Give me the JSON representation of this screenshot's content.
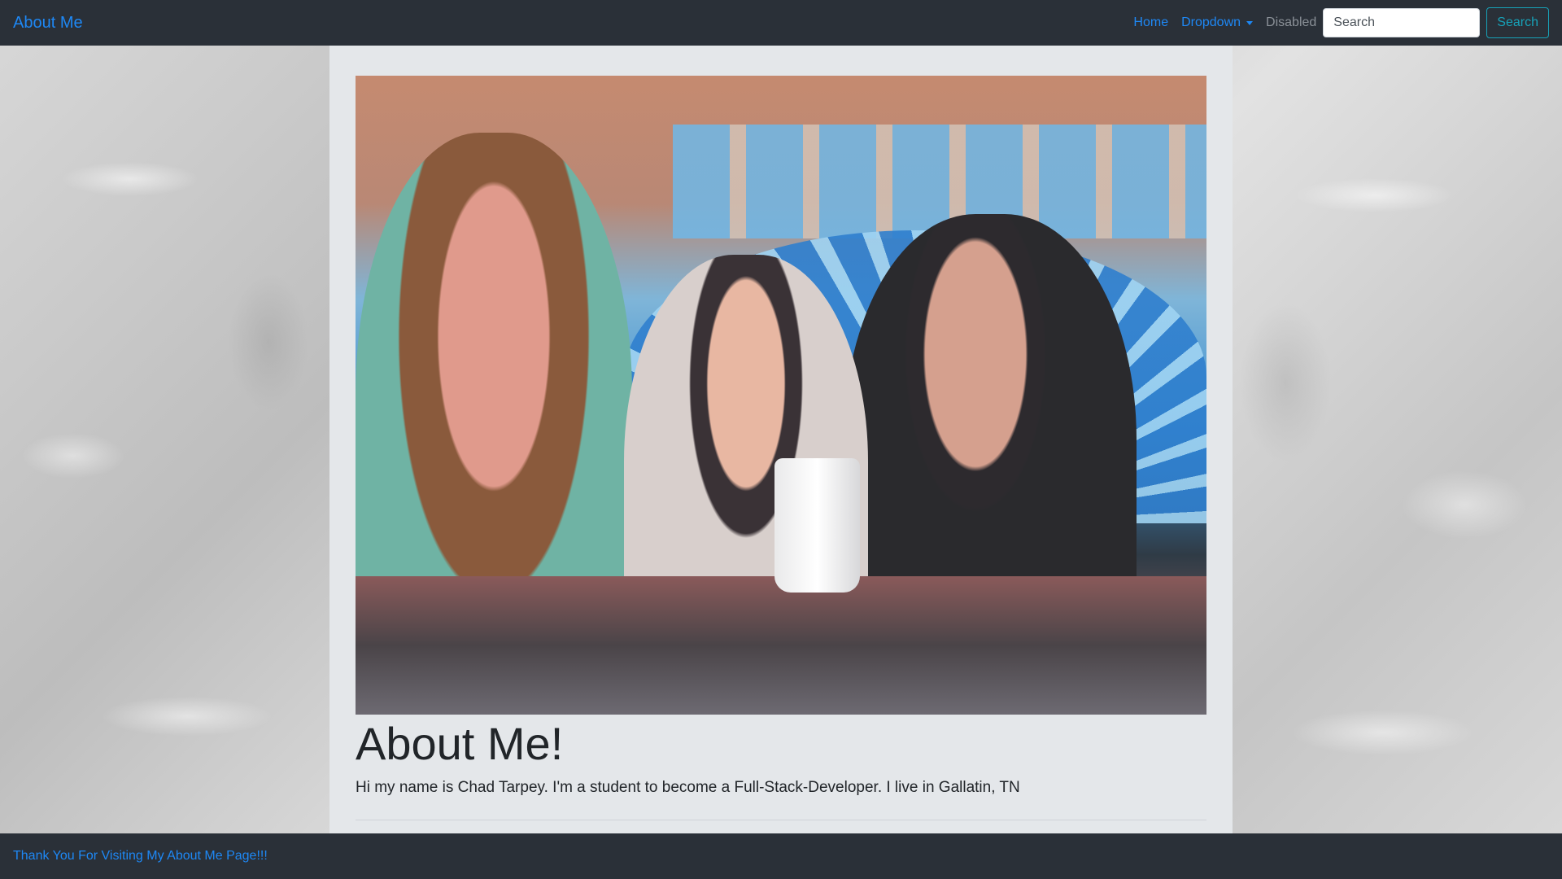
{
  "navbar": {
    "brand": "About Me",
    "links": {
      "home": "Home",
      "dropdown": "Dropdown",
      "disabled": "Disabled"
    },
    "search": {
      "placeholder": "Search",
      "button_label": "Search"
    }
  },
  "main": {
    "photo_alt": "Family photo",
    "heading": "About Me!",
    "intro": "Hi my name is Chad Tarpey. I'm a student to become a Full-Stack-Developer. I live in Gallatin, TN"
  },
  "footer": {
    "text": "Thank You For Visiting My About Me Page!!!"
  },
  "colors": {
    "navbar_bg": "#2a3038",
    "link": "#1e88f5",
    "search_outline": "#17a2b8",
    "container_bg": "#e4e7ea"
  }
}
